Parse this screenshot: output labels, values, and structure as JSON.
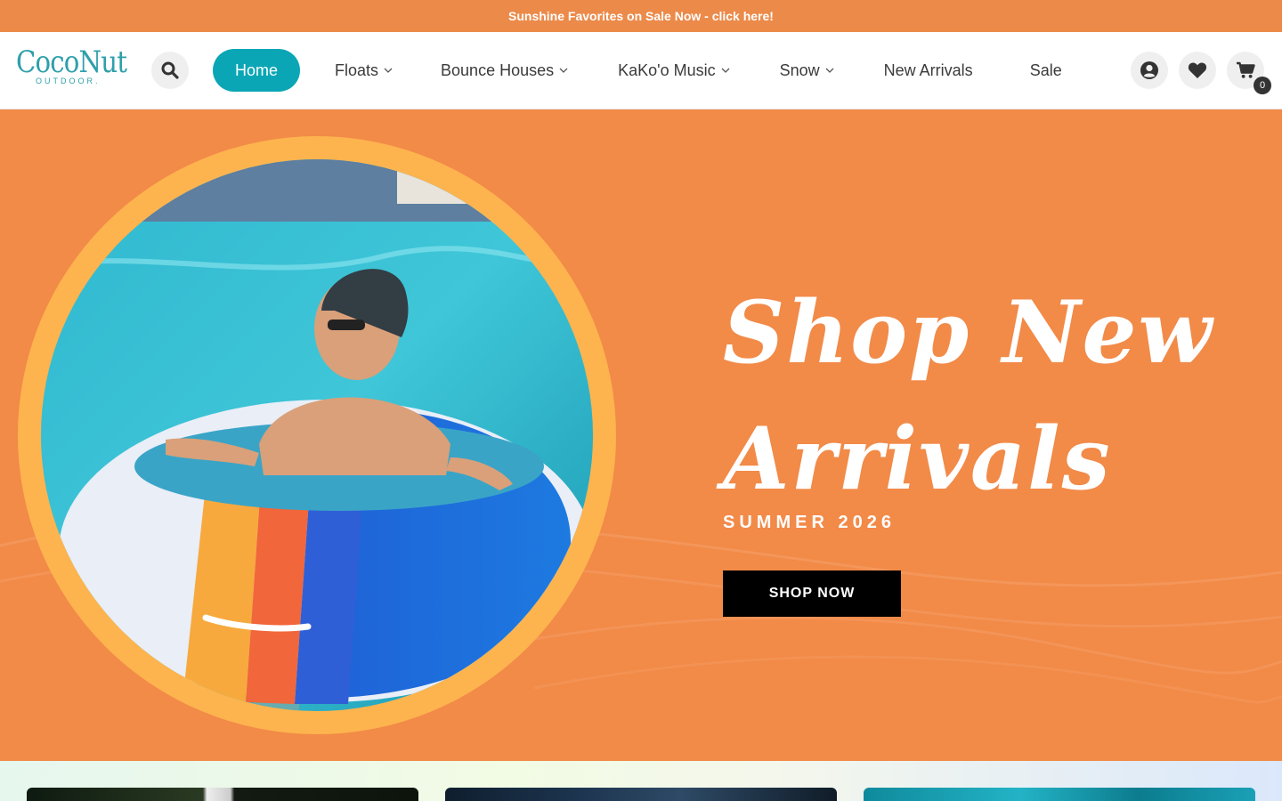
{
  "announcement": {
    "text": "Sunshine Favorites on Sale Now - click here!"
  },
  "header": {
    "logo": {
      "main": "CocoNut",
      "sub": "OUTDOOR."
    },
    "nav": [
      {
        "label": "Home",
        "active": true,
        "has_dropdown": false
      },
      {
        "label": "Floats",
        "active": false,
        "has_dropdown": true
      },
      {
        "label": "Bounce Houses",
        "active": false,
        "has_dropdown": true
      },
      {
        "label": "KaKo'o Music",
        "active": false,
        "has_dropdown": true
      },
      {
        "label": "Snow",
        "active": false,
        "has_dropdown": true
      },
      {
        "label": "New Arrivals",
        "active": false,
        "has_dropdown": false
      },
      {
        "label": "Sale",
        "active": false,
        "has_dropdown": false
      }
    ],
    "icons": {
      "search": "search-icon",
      "account": "user-circle-icon",
      "wishlist": "heart-icon",
      "cart": "cart-icon"
    },
    "cart_count": "0"
  },
  "hero": {
    "title_line1": "Shop New",
    "title_line2": "Arrivals",
    "subtitle": "SUMMER 2026",
    "cta": "SHOP NOW"
  },
  "colors": {
    "announcement_bg": "#ec8a4a",
    "hero_bg": "#f28a48",
    "ring": "#fdb44e",
    "accent_teal": "#0aa6b5",
    "logo_teal": "#2ea0ab",
    "cta_bg": "#000000"
  }
}
